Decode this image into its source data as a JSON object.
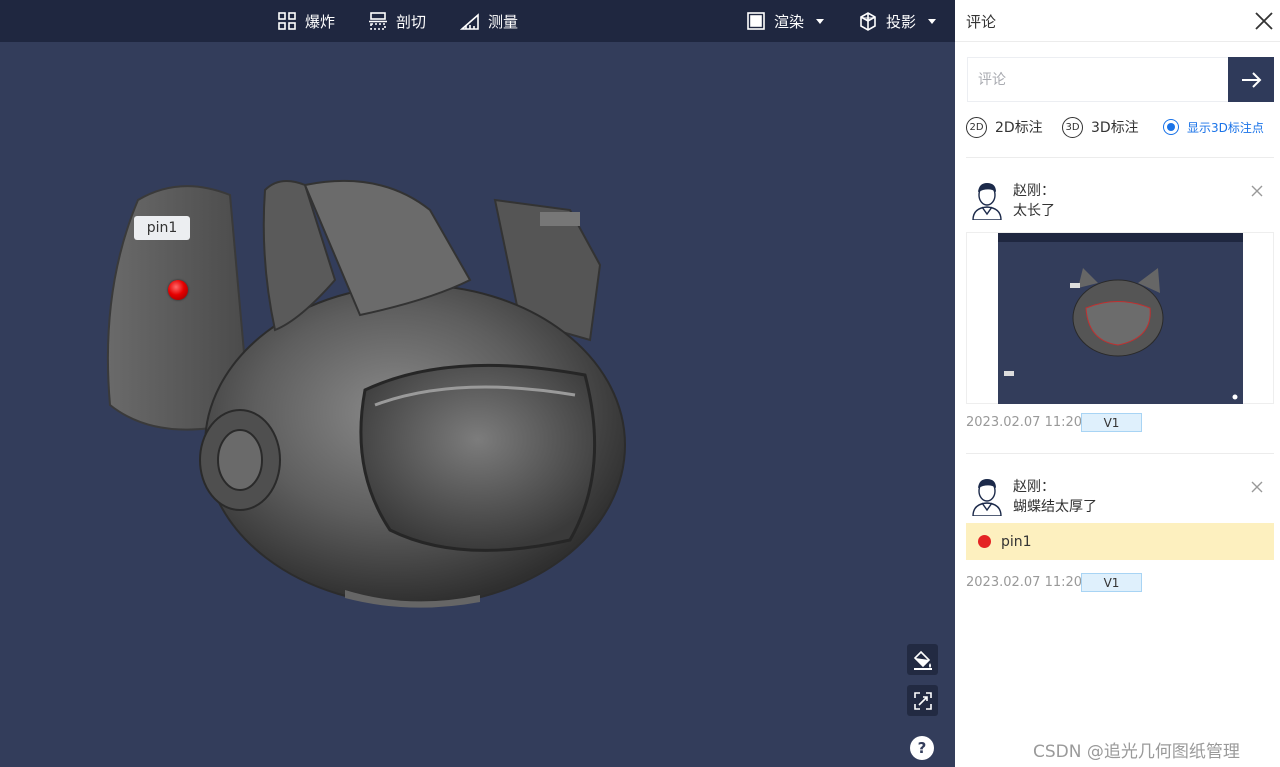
{
  "toolbar": {
    "explode_label": "爆炸",
    "section_label": "剖切",
    "measure_label": "测量",
    "render_label": "渲染",
    "projection_label": "投影"
  },
  "viewport": {
    "pin_label": "pin1",
    "background_color": "#333d5b",
    "toolbar_color": "#1f2740",
    "help_label": "?"
  },
  "panel": {
    "title": "评论",
    "input_placeholder": "评论",
    "filters": {
      "annot2d_badge": "2D",
      "annot2d_label": "2D标注",
      "annot3d_badge": "3D",
      "annot3d_label": "3D标注",
      "show3d_label": "显示3D标注点"
    },
    "comments": [
      {
        "author": "赵刚：",
        "message": "太长了",
        "timestamp": "2023.02.07 11:20",
        "version": "V1"
      },
      {
        "author": "赵刚：",
        "message": "蝴蝶结太厚了",
        "pin_ref": "pin1",
        "timestamp": "2023.02.07 11:20",
        "version": "V1"
      }
    ]
  },
  "watermark": "CSDN @追光几何图纸管理",
  "colors": {
    "accent_blue": "#1a73e8",
    "send_button": "#2f3a5a",
    "pin_red": "#e42424",
    "pin_highlight": "#fdf0bf",
    "version_badge": "#dff0fc"
  }
}
